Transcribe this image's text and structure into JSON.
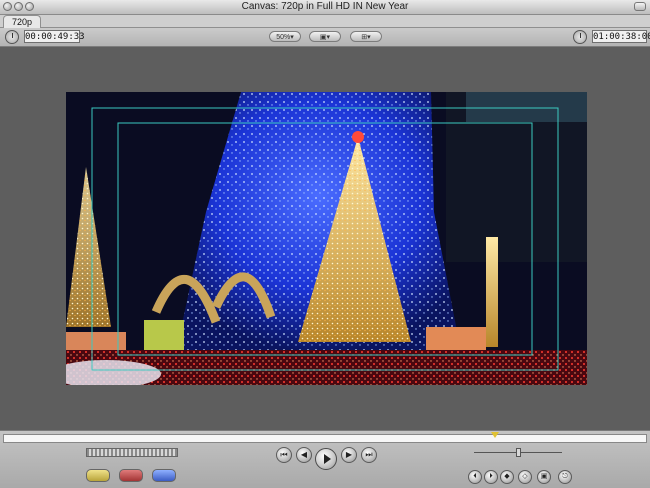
{
  "window": {
    "title": "Canvas: 720p in Full HD IN New Year"
  },
  "tabs": [
    {
      "label": "720p"
    }
  ],
  "toolbar": {
    "current_timecode": "00:00:49:33",
    "zoom": "50%",
    "view_icon": "view-options-icon",
    "overlay_icon": "overlay-options-icon",
    "duration_timecode": "01:00:38:00"
  },
  "transport": {
    "icons": [
      "go-to-in-icon",
      "play-reverse-icon",
      "play-icon",
      "play-forward-icon",
      "go-to-out-icon"
    ]
  },
  "edit_buttons": {
    "icons": [
      "mark-in-icon",
      "mark-out-icon",
      "split-edit-icon",
      "add-keyframe-icon",
      "match-frame-icon",
      "marker-icon",
      "record-icon"
    ]
  },
  "colors": {
    "accent_yellow": "#e0c233",
    "title_safe": "#3bc9c0",
    "background": "#5e5e5e"
  }
}
